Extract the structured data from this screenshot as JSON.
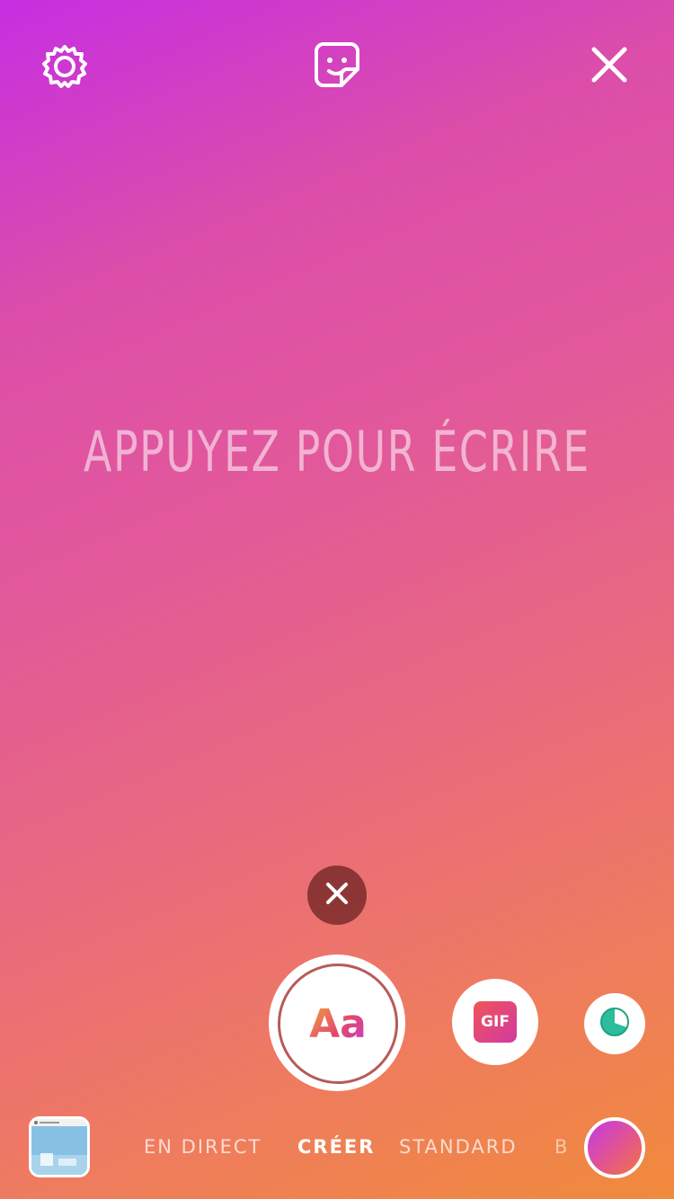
{
  "top_bar": {
    "settings_icon": "gear-icon",
    "sticker_icon": "sticker-face-icon",
    "close_icon": "close-icon"
  },
  "canvas": {
    "prompt": "APPUYEZ POUR ÉCRIRE"
  },
  "dismiss": {
    "icon": "close-icon"
  },
  "modes": {
    "text_label": "Aa",
    "gif_label": "GIF",
    "poll_icon": "poll-chart-icon"
  },
  "bottom_bar": {
    "tabs": [
      "EN DIRECT",
      "CRÉER",
      "STANDARD",
      "B"
    ],
    "selected_tab": "CRÉER"
  },
  "colors": {
    "gradient_start": "#c72ee2",
    "gradient_end": "#f08a3c",
    "text_prompt": "rgba(255,255,255,0.55)"
  }
}
